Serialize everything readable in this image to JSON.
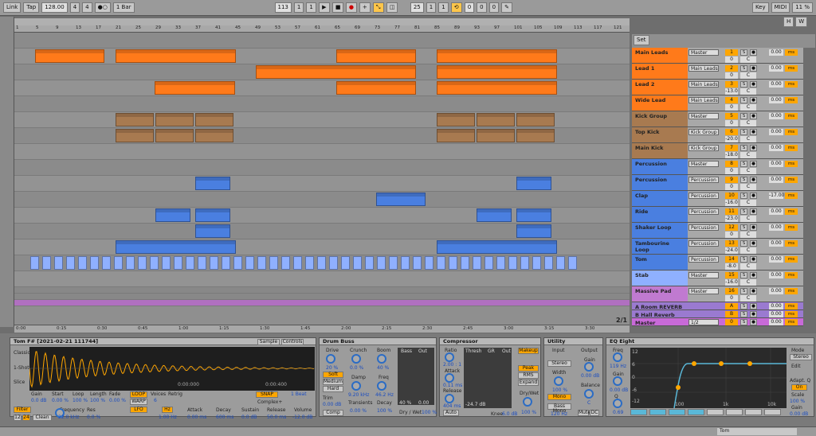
{
  "transport": {
    "link": "Link",
    "tap": "Tap",
    "tempo": "128.00",
    "sig_num": "4",
    "sig_den": "4",
    "metro": "●○",
    "quant": "1 Bar",
    "pos_bar": "113",
    "pos_beat": "1",
    "pos_six": "1",
    "loop_bar": "25",
    "loop_beat": "1",
    "loop_six": "1",
    "len_bar": "0",
    "len_beat": "0",
    "len_six": "0",
    "key": "Key",
    "midi": "MIDI",
    "cpu": "11 %",
    "hw": "H",
    "w": "W"
  },
  "ruler_ticks": [
    "1",
    "5",
    "9",
    "13",
    "17",
    "21",
    "25",
    "29",
    "33",
    "37",
    "41",
    "45",
    "49",
    "53",
    "57",
    "61",
    "65",
    "69",
    "73",
    "77",
    "81",
    "85",
    "89",
    "93",
    "97",
    "101",
    "105",
    "109",
    "113",
    "117",
    "121"
  ],
  "time_ticks": [
    "0:00",
    "0:15",
    "0:30",
    "0:45",
    "1:00",
    "1:15",
    "1:30",
    "1:45",
    "2:00",
    "2:15",
    "2:30",
    "2:45",
    "3:00",
    "3:15",
    "3:30"
  ],
  "set_label": "Set",
  "page_indicator": "2/1",
  "tracks": [
    {
      "name": "Main Leads",
      "io": "Master",
      "num": "1",
      "vol": "0.00",
      "color": "#ff7a1a",
      "pan": "0",
      "c": "C"
    },
    {
      "name": "Lead 1",
      "io": "Main Leads",
      "num": "2",
      "vol": "0.00",
      "color": "#ff7a1a",
      "pan": "0",
      "c": "C"
    },
    {
      "name": "Lead 2",
      "io": "Main Leads",
      "num": "3",
      "vol": "0.00",
      "color": "#ff7a1a",
      "pan": "-13.0",
      "c": "C"
    },
    {
      "name": "Wide Lead",
      "io": "Main Leads",
      "num": "4",
      "vol": "0.00",
      "color": "#ff7a1a",
      "pan": "0",
      "c": "C"
    },
    {
      "name": "Kick Group",
      "io": "Master",
      "num": "5",
      "vol": "0.00",
      "color": "#a87a50",
      "pan": "0",
      "c": "C"
    },
    {
      "name": "Top Kick",
      "io": "Kick Group",
      "num": "6",
      "vol": "0.00",
      "color": "#a87a50",
      "pan": "-20.0",
      "c": "C"
    },
    {
      "name": "Main Kick",
      "io": "Kick Group",
      "num": "7",
      "vol": "0.00",
      "color": "#a87a50",
      "pan": "-18.0",
      "c": "C"
    },
    {
      "name": "Percussion",
      "io": "Master",
      "num": "8",
      "vol": "0.00",
      "color": "#4a7fe0",
      "pan": "0",
      "c": "C"
    },
    {
      "name": "Percussion",
      "io": "Percussion",
      "num": "9",
      "vol": "0.00",
      "color": "#4a7fe0",
      "pan": "0",
      "c": "C"
    },
    {
      "name": "Clap",
      "io": "Percussion",
      "num": "10",
      "vol": "-17.00",
      "color": "#4a7fe0",
      "pan": "-16.0",
      "c": "C"
    },
    {
      "name": "Ride",
      "io": "Percussion",
      "num": "11",
      "vol": "0.00",
      "color": "#4a7fe0",
      "pan": "-23.0",
      "c": "C"
    },
    {
      "name": "Shaker Loop",
      "io": "Percussion",
      "num": "12",
      "vol": "0.00",
      "color": "#4a7fe0",
      "pan": "0",
      "c": "C"
    },
    {
      "name": "Tambourine Loop",
      "io": "Percussion",
      "num": "13",
      "vol": "0.00",
      "color": "#4a7fe0",
      "pan": "-24.0",
      "c": "C"
    },
    {
      "name": "Tom",
      "io": "Percussion",
      "num": "14",
      "vol": "0.00",
      "color": "#4a7fe0",
      "pan": "-8.0",
      "c": "C"
    },
    {
      "name": "Stab",
      "io": "Master",
      "num": "15",
      "vol": "0.00",
      "color": "#8fb0ff",
      "pan": "-16.0",
      "c": "C"
    },
    {
      "name": "Massive Pad",
      "io": "Master",
      "num": "16",
      "vol": "0.00",
      "color": "#c07ad0",
      "pan": "0",
      "c": "C"
    }
  ],
  "returns": [
    {
      "name": "A Room REVERB",
      "num": "A",
      "vol": "0.00"
    },
    {
      "name": "B Hall Reverb",
      "num": "B",
      "vol": "0.00"
    },
    {
      "name": "Master",
      "io": "1/2",
      "num": "0",
      "vol": "0.00"
    }
  ],
  "device_sample": {
    "title": "Tom F# [2021-02-21 111744]",
    "tab1": "Sample",
    "tab2": "Controls",
    "classic": "Classic",
    "oneshot": "1-Shot",
    "slice": "Slice",
    "gain_l": "Gain",
    "gain_v": "0.0 dB",
    "start_l": "Start",
    "start_v": "0.00 %",
    "loop_l": "Loop",
    "loop_v": "100 %",
    "length_l": "Length",
    "length_v": "100 %",
    "fade_l": "Fade",
    "fade_v": "0.00 %",
    "t1": "0:00:000",
    "t2": "0:00:400",
    "snap": "SNAP",
    "beat": "1 Beat",
    "complex": "Complex+",
    "voices_l": "Voices",
    "voices_v": "6",
    "retrig": "Retrig",
    "filter": "Filter",
    "freq_l": "Frequency",
    "freq_v": "22.0 kHz",
    "res_l": "Res",
    "res_v": "0.0 %",
    "clean": "Clean",
    "n12": "12",
    "n24": "24",
    "lfo": "LFO",
    "hz": "Hz",
    "lfo_v": "1.00 Hz",
    "attack_l": "Attack",
    "attack_v": "0.00 ms",
    "decay_l": "Decay",
    "decay_v": "600 ms",
    "sustain_l": "Sustain",
    "sustain_v": "0.0 dB",
    "release_l": "Release",
    "release_v": "50.0 ms",
    "volume_l": "Volume",
    "volume_v": "-12.0 dB"
  },
  "device_drum": {
    "title": "Drum Buss",
    "drive_l": "Drive",
    "drive_v": "20 %",
    "crunch_l": "Crunch",
    "crunch_v": "0.0 %",
    "boom_l": "Boom",
    "boom_v": "40 %",
    "soft": "Soft",
    "medium": "Medium",
    "hard": "Hard",
    "damp_l": "Damp",
    "damp_v": "9.20 kHz",
    "freq_l": "Freq",
    "freq_v": "46.2 Hz",
    "trim_l": "Trim",
    "trim_v": "0.00 dB",
    "trans_l": "Transients",
    "trans_v": "0.00 %",
    "decay_l": "Decay",
    "decay_v": "100 %",
    "comp": "Comp",
    "bass_l": "Bass",
    "out_l": "Out",
    "dw": "Dry / Wet",
    "dw_v": "100 %",
    "p40": "40 %",
    "p0": "0.00"
  },
  "device_comp": {
    "title": "Compressor",
    "ratio_l": "Ratio",
    "ratio_v": "2.00 : 1",
    "attack_l": "Attack",
    "attack_v": "0.11 ms",
    "release_l": "Release",
    "release_v": "404 ms",
    "auto": "Auto",
    "thresh_l": "Thresh",
    "gr_l": "GR",
    "out_l": "Out",
    "thresh_v": "-24.7 dB",
    "knee_l": "Knee",
    "knee_v": "6.0 dB",
    "makeup": "Makeup",
    "peak": "Peak",
    "rms": "RMS",
    "expand": "Expand",
    "dw_l": "Dry/Wet",
    "dw_v": "100 %"
  },
  "device_util": {
    "title": "Utility",
    "input_l": "Input",
    "output_l": "Output",
    "stereo": "Stereo",
    "gain_l": "Gain",
    "gain_v": "0.00 dB",
    "width_l": "Width",
    "width_v": "100 %",
    "balance_l": "Balance",
    "balance_v": "C",
    "mono": "Mono",
    "bass_mono": "Bass Mono",
    "hz": "120 Hz",
    "mute": "Mute",
    "dc": "DC"
  },
  "device_eq": {
    "title": "EQ Eight",
    "freq_l": "Freq",
    "freq_v": "119 Hz",
    "gain_l": "Gain",
    "gain_v": "0.00 dB",
    "q_l": "Q",
    "q_v": "0.69",
    "mode_l": "Mode",
    "mode_v": "Stereo",
    "edit": "Edit",
    "adapt": "Adapt. Q",
    "on": "On",
    "scale_l": "Scale",
    "scale_v": "100 %",
    "gain2_l": "Gain",
    "gain2_v": "0.00 dB",
    "db12": "12",
    "db6": "6",
    "db0": "0",
    "dbm6": "-6",
    "dbm12": "-12",
    "k1": "100",
    "k2": "1k",
    "k3": "10k"
  },
  "status": {
    "track": "Tom"
  }
}
